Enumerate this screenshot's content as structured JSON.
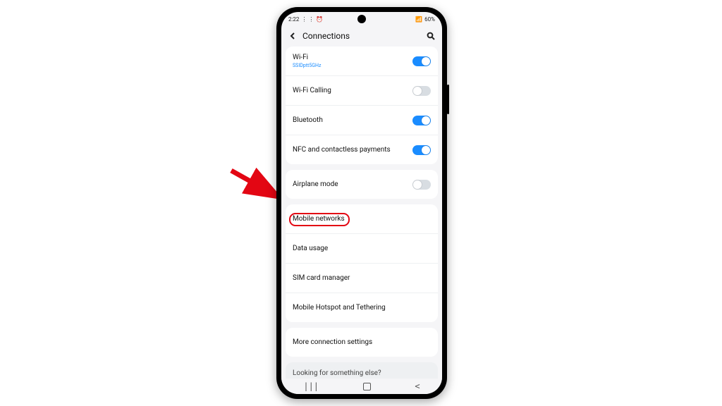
{
  "status": {
    "time": "2:22",
    "extra": "⋮ ⋮",
    "alarm": "⏰",
    "battery": "60%"
  },
  "header": {
    "title": "Connections"
  },
  "group1": [
    {
      "label": "Wi-Fi",
      "sub": "SSIDptt5GHz",
      "toggle": true,
      "on": true
    },
    {
      "label": "Wi-Fi Calling",
      "toggle": true,
      "on": false
    },
    {
      "label": "Bluetooth",
      "toggle": true,
      "on": true
    },
    {
      "label": "NFC and contactless payments",
      "toggle": true,
      "on": true
    }
  ],
  "group2": [
    {
      "label": "Airplane mode",
      "toggle": true,
      "on": false
    }
  ],
  "group3": [
    {
      "label": "Mobile networks"
    },
    {
      "label": "Data usage"
    },
    {
      "label": "SIM card manager"
    },
    {
      "label": "Mobile Hotspot and Tethering"
    }
  ],
  "group4": [
    {
      "label": "More connection settings"
    }
  ],
  "footer": {
    "text": "Looking for something else?"
  },
  "annotation": {
    "highlight_target": "Mobile networks"
  }
}
